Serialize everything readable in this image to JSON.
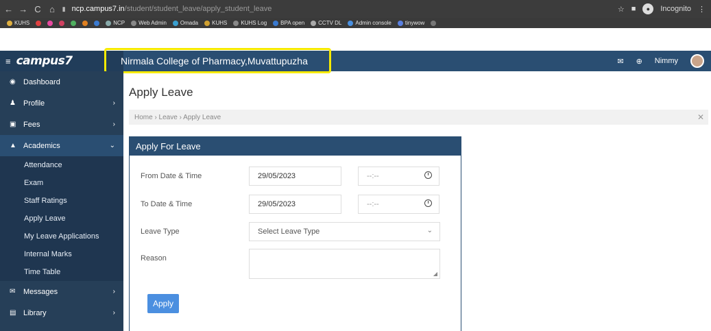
{
  "browser": {
    "url_host": "ncp.campus7.in",
    "url_path": "/student/student_leave/apply_student_leave",
    "incognito_label": "Incognito"
  },
  "bookmarks": [
    "KUHS",
    "NCP",
    "Web Admin",
    "Omada",
    "KUHS",
    "KUHS Log",
    "BPA open",
    "CCTV DL",
    "Admin console",
    "tinywow"
  ],
  "header": {
    "logo": "campus7",
    "college_name": "Nirmala College of Pharmacy,Muvattupuzha",
    "user_name": "Nimmy"
  },
  "sidebar": {
    "items": [
      {
        "label": "Dashboard",
        "icon": "dashboard-icon"
      },
      {
        "label": "Profile",
        "icon": "user-icon"
      },
      {
        "label": "Fees",
        "icon": "money-icon"
      },
      {
        "label": "Academics",
        "icon": "graduation-cap-icon"
      },
      {
        "label": "Messages",
        "icon": "envelope-icon"
      },
      {
        "label": "Library",
        "icon": "book-icon"
      }
    ],
    "sub_items": [
      "Attendance",
      "Exam",
      "Staff Ratings",
      "Apply Leave",
      "My Leave Applications",
      "Internal Marks",
      "Time Table"
    ]
  },
  "main": {
    "title": "Apply Leave",
    "breadcrumb": "Home › Leave › Apply Leave",
    "panel": {
      "title": "Apply For Leave",
      "from_label": "From Date & Time",
      "from_date": "29/05/2023",
      "from_time": "--:--",
      "to_label": "To Date & Time",
      "to_date": "29/05/2023",
      "to_time": "--:--",
      "leave_type_label": "Leave Type",
      "leave_type_value": "Select Leave Type",
      "reason_label": "Reason",
      "apply_label": "Apply"
    }
  },
  "colors": {
    "header": "#2a4e72",
    "sidebar": "#263f58",
    "highlight": "#f6ea00",
    "button": "#4b8fe0"
  }
}
